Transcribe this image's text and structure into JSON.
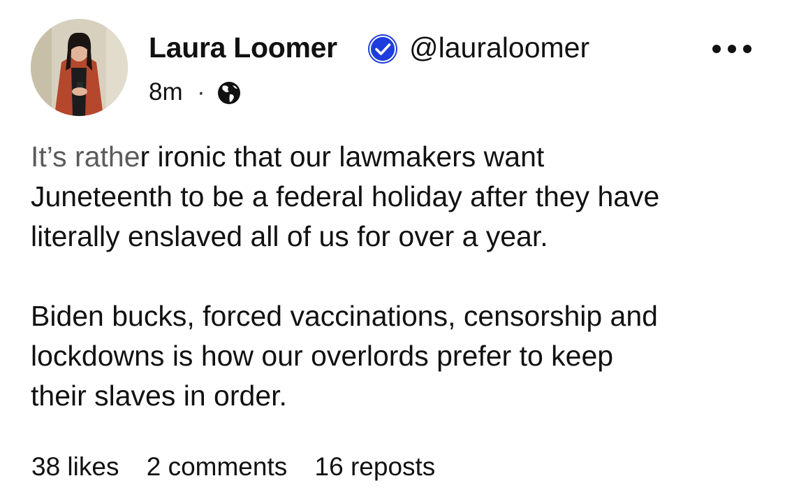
{
  "post": {
    "author": {
      "display_name": "Laura Loomer",
      "handle": "@lauraloomer",
      "verified": true,
      "verified_color": "#1d3ddc"
    },
    "timestamp": "8m",
    "separator": "·",
    "visibility_icon": "globe-icon",
    "menu_icon": "more-dots-icon",
    "body": {
      "paragraph1": {
        "line1_faded": "It’s rathe",
        "line1_rest": "r ironic that our lawmakers want",
        "line2": "Juneteenth to be a federal holiday after they have",
        "line3": "literally enslaved all of us for over a year."
      },
      "paragraph2": {
        "line1": "Biden bucks, forced vaccinations, censorship and",
        "line2": "lockdowns is how our overlords prefer to keep",
        "line3": "their slaves in order."
      }
    },
    "stats": {
      "likes": "38 likes",
      "comments": "2 comments",
      "reposts": "16 reposts"
    }
  }
}
